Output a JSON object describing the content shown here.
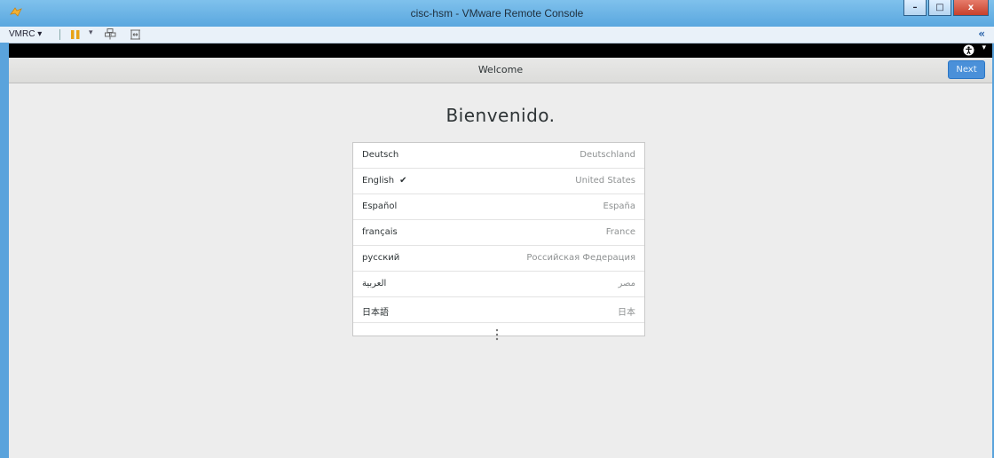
{
  "window": {
    "title": "cisc-hsm - VMware Remote Console",
    "minimize_glyph": "–",
    "maximize_glyph": "□",
    "close_glyph": "x"
  },
  "toolbar": {
    "vmrc_label": "VMRC ▾",
    "pause_caret": "▾",
    "collapse_glyph": "«"
  },
  "guest_top": {
    "menu_caret": "▾"
  },
  "header": {
    "title": "Welcome",
    "next_label": "Next"
  },
  "heading": "Bienvenido.",
  "languages": [
    {
      "name": "Deutsch",
      "region": "Deutschland",
      "selected": false
    },
    {
      "name": "English",
      "region": "United States",
      "selected": true
    },
    {
      "name": "Español",
      "region": "España",
      "selected": false
    },
    {
      "name": "français",
      "region": "France",
      "selected": false
    },
    {
      "name": "русский",
      "region": "Российская Федерация",
      "selected": false
    },
    {
      "name": "العربية",
      "region": "مصر",
      "selected": false
    },
    {
      "name": "日本語",
      "region": "日本",
      "selected": false
    }
  ],
  "check_glyph": "✔",
  "colors": {
    "accent": "#4a90d9",
    "window_frame": "#5aa3dc",
    "background": "#ededed"
  }
}
